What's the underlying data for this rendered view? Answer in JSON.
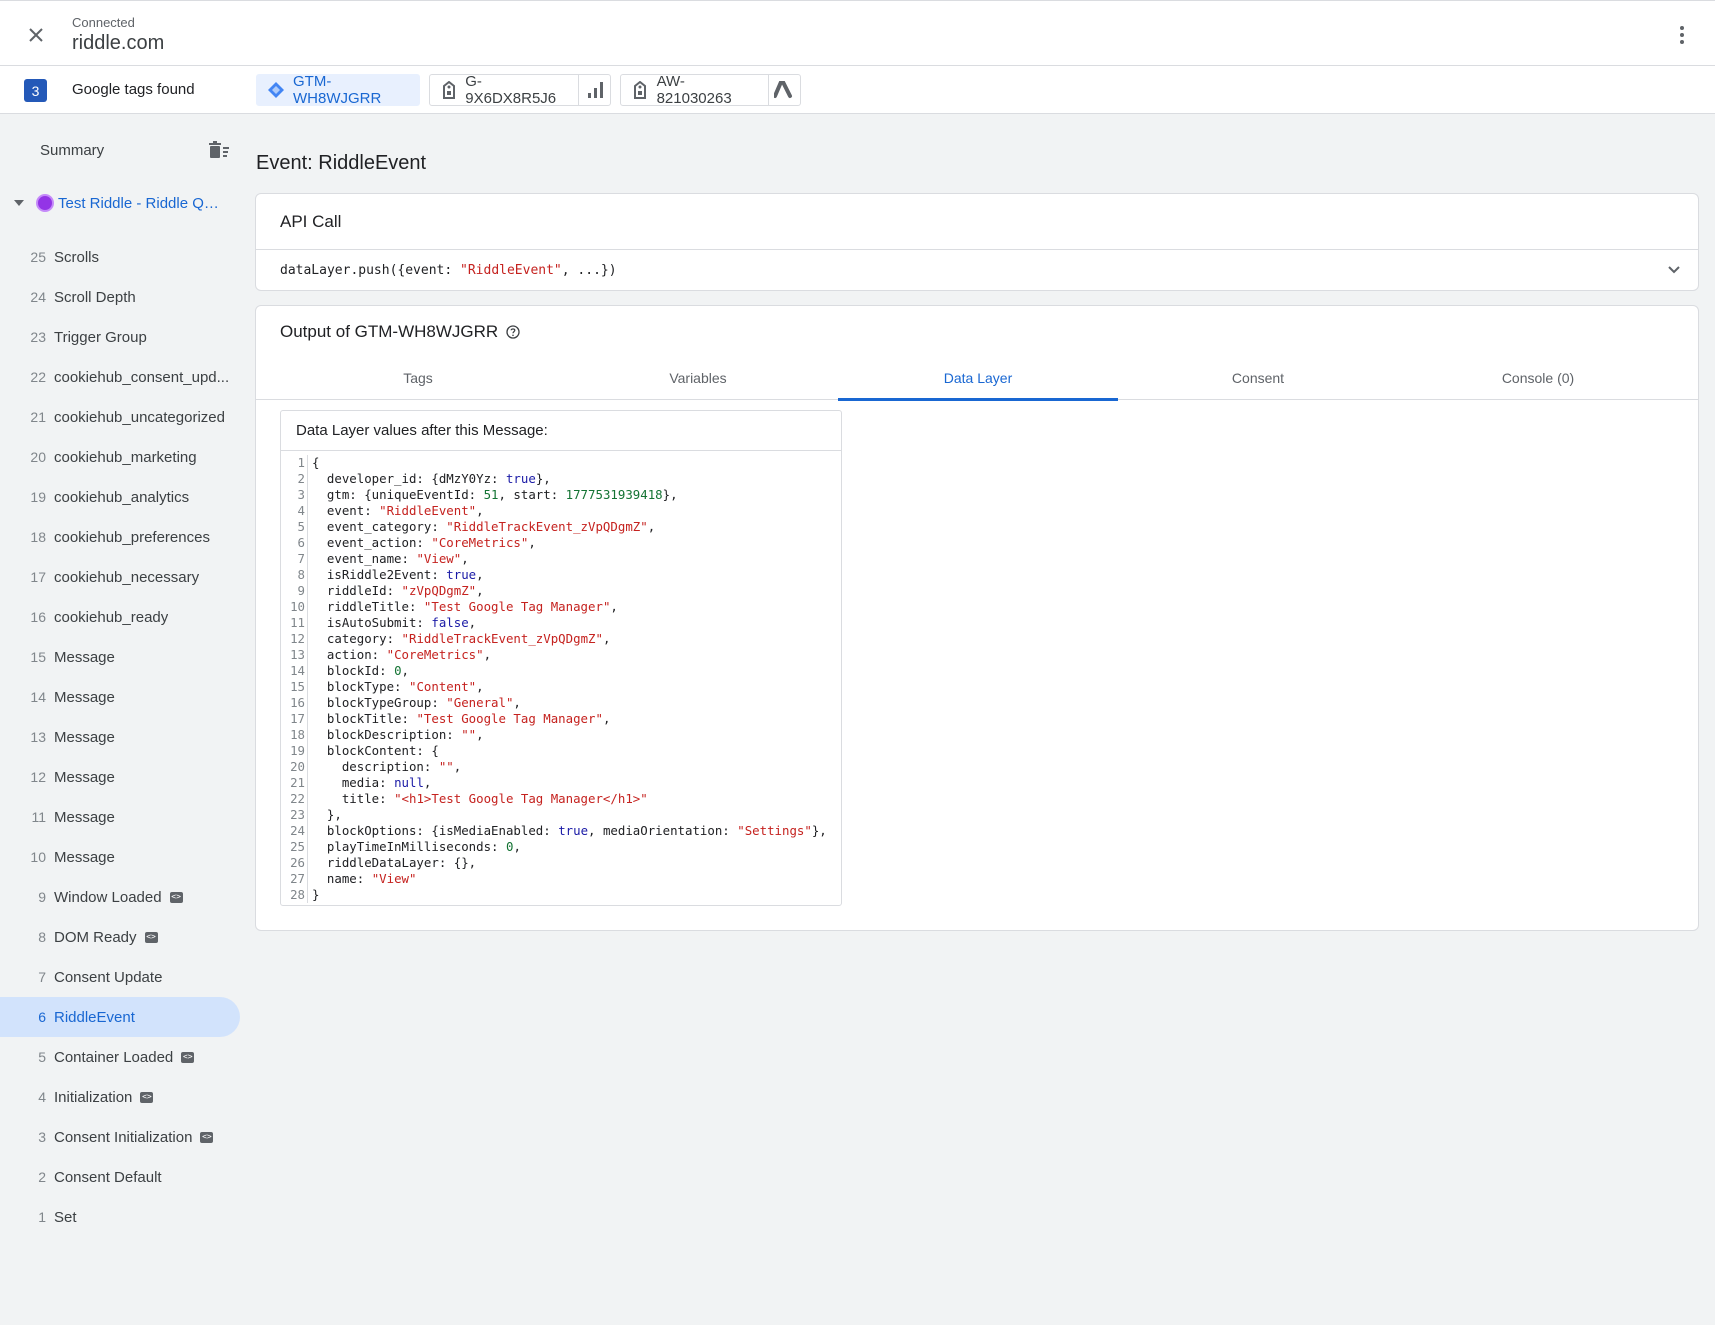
{
  "header": {
    "status": "Connected",
    "site": "riddle.com"
  },
  "tagbar": {
    "count": "3",
    "label": "Google tags found",
    "chips": [
      {
        "id": "GTM-WH8WJGRR",
        "icon": "gtm-diamond-icon"
      },
      {
        "id": "G-9X6DX8R5J6",
        "icon": "tag-icon",
        "tail_icon": "analytics-bars-icon"
      },
      {
        "id": "AW-821030263",
        "icon": "tag-icon",
        "tail_icon": "google-ads-icon"
      }
    ]
  },
  "sidebar": {
    "summary": "Summary",
    "page_title": "Test Riddle - Riddle Qui...",
    "events": [
      {
        "num": "25",
        "label": "Scrolls"
      },
      {
        "num": "24",
        "label": "Scroll Depth"
      },
      {
        "num": "23",
        "label": "Trigger Group"
      },
      {
        "num": "22",
        "label": "cookiehub_consent_upd..."
      },
      {
        "num": "21",
        "label": "cookiehub_uncategorized"
      },
      {
        "num": "20",
        "label": "cookiehub_marketing"
      },
      {
        "num": "19",
        "label": "cookiehub_analytics"
      },
      {
        "num": "18",
        "label": "cookiehub_preferences"
      },
      {
        "num": "17",
        "label": "cookiehub_necessary"
      },
      {
        "num": "16",
        "label": "cookiehub_ready"
      },
      {
        "num": "15",
        "label": "Message"
      },
      {
        "num": "14",
        "label": "Message"
      },
      {
        "num": "13",
        "label": "Message"
      },
      {
        "num": "12",
        "label": "Message"
      },
      {
        "num": "11",
        "label": "Message"
      },
      {
        "num": "10",
        "label": "Message"
      },
      {
        "num": "9",
        "label": "Window Loaded"
      },
      {
        "num": "8",
        "label": "DOM Ready"
      },
      {
        "num": "7",
        "label": "Consent Update"
      },
      {
        "num": "6",
        "label": "RiddleEvent"
      },
      {
        "num": "5",
        "label": "Container Loaded"
      },
      {
        "num": "4",
        "label": "Initialization"
      },
      {
        "num": "3",
        "label": "Consent Initialization"
      },
      {
        "num": "2",
        "label": "Consent Default"
      },
      {
        "num": "1",
        "label": "Set"
      }
    ]
  },
  "main": {
    "event_title": "Event: RiddleEvent",
    "api_call": {
      "heading": "API Call",
      "code_prefix": "dataLayer.push({event: ",
      "code_event": "\"RiddleEvent\"",
      "code_suffix": ", ...})"
    },
    "output": {
      "heading": "Output of GTM-WH8WJGRR",
      "tabs": [
        "Tags",
        "Variables",
        "Data Layer",
        "Consent",
        "Console (0)"
      ],
      "active_tab": "Data Layer",
      "datalayer_title": "Data Layer values after this Message:",
      "code_lines": [
        [
          [
            "p",
            "{"
          ]
        ],
        [
          [
            "p",
            "  developer_id: {dMzY0Yz: "
          ],
          [
            "k",
            "true"
          ],
          [
            "p",
            "},"
          ]
        ],
        [
          [
            "p",
            "  gtm: {uniqueEventId: "
          ],
          [
            "n",
            "51"
          ],
          [
            "p",
            ", start: "
          ],
          [
            "n",
            "1777531939418"
          ],
          [
            "p",
            "},"
          ]
        ],
        [
          [
            "p",
            "  event: "
          ],
          [
            "s",
            "\"RiddleEvent\""
          ],
          [
            "p",
            ","
          ]
        ],
        [
          [
            "p",
            "  event_category: "
          ],
          [
            "s",
            "\"RiddleTrackEvent_zVpQDgmZ\""
          ],
          [
            "p",
            ","
          ]
        ],
        [
          [
            "p",
            "  event_action: "
          ],
          [
            "s",
            "\"CoreMetrics\""
          ],
          [
            "p",
            ","
          ]
        ],
        [
          [
            "p",
            "  event_name: "
          ],
          [
            "s",
            "\"View\""
          ],
          [
            "p",
            ","
          ]
        ],
        [
          [
            "p",
            "  isRiddle2Event: "
          ],
          [
            "k",
            "true"
          ],
          [
            "p",
            ","
          ]
        ],
        [
          [
            "p",
            "  riddleId: "
          ],
          [
            "s",
            "\"zVpQDgmZ\""
          ],
          [
            "p",
            ","
          ]
        ],
        [
          [
            "p",
            "  riddleTitle: "
          ],
          [
            "s",
            "\"Test Google Tag Manager\""
          ],
          [
            "p",
            ","
          ]
        ],
        [
          [
            "p",
            "  isAutoSubmit: "
          ],
          [
            "k",
            "false"
          ],
          [
            "p",
            ","
          ]
        ],
        [
          [
            "p",
            "  category: "
          ],
          [
            "s",
            "\"RiddleTrackEvent_zVpQDgmZ\""
          ],
          [
            "p",
            ","
          ]
        ],
        [
          [
            "p",
            "  action: "
          ],
          [
            "s",
            "\"CoreMetrics\""
          ],
          [
            "p",
            ","
          ]
        ],
        [
          [
            "p",
            "  blockId: "
          ],
          [
            "n",
            "0"
          ],
          [
            "p",
            ","
          ]
        ],
        [
          [
            "p",
            "  blockType: "
          ],
          [
            "s",
            "\"Content\""
          ],
          [
            "p",
            ","
          ]
        ],
        [
          [
            "p",
            "  blockTypeGroup: "
          ],
          [
            "s",
            "\"General\""
          ],
          [
            "p",
            ","
          ]
        ],
        [
          [
            "p",
            "  blockTitle: "
          ],
          [
            "s",
            "\"Test Google Tag Manager\""
          ],
          [
            "p",
            ","
          ]
        ],
        [
          [
            "p",
            "  blockDescription: "
          ],
          [
            "s",
            "\"\""
          ],
          [
            "p",
            ","
          ]
        ],
        [
          [
            "p",
            "  blockContent: {"
          ]
        ],
        [
          [
            "p",
            "    description: "
          ],
          [
            "s",
            "\"\""
          ],
          [
            "p",
            ","
          ]
        ],
        [
          [
            "p",
            "    media: "
          ],
          [
            "k",
            "null"
          ],
          [
            "p",
            ","
          ]
        ],
        [
          [
            "p",
            "    title: "
          ],
          [
            "s",
            "\"<h1>Test Google Tag Manager</h1>\""
          ]
        ],
        [
          [
            "p",
            "  },"
          ]
        ],
        [
          [
            "p",
            "  blockOptions: {isMediaEnabled: "
          ],
          [
            "k",
            "true"
          ],
          [
            "p",
            ", mediaOrientation: "
          ],
          [
            "s",
            "\"Settings\""
          ],
          [
            "p",
            "},"
          ]
        ],
        [
          [
            "p",
            "  playTimeInMilliseconds: "
          ],
          [
            "n",
            "0"
          ],
          [
            "p",
            ","
          ]
        ],
        [
          [
            "p",
            "  riddleDataLayer: {},"
          ]
        ],
        [
          [
            "p",
            "  name: "
          ],
          [
            "s",
            "\"View\""
          ]
        ],
        [
          [
            "p",
            "}"
          ]
        ]
      ]
    }
  },
  "colors": {
    "accent": "#1967d2",
    "selected_bg": "#d2e3fc",
    "string": "#c5221f",
    "number": "#137333",
    "keyword": "#1a1aa6"
  }
}
